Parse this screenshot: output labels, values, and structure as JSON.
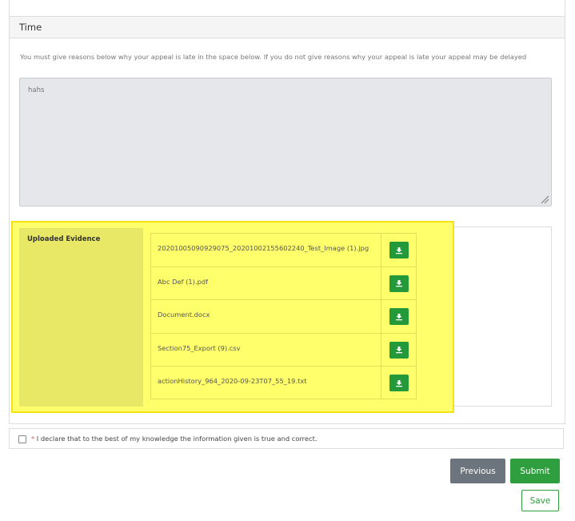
{
  "section": {
    "title": "Time",
    "instructions": "You must give reasons below why your appeal is late in the space below. If you do not give reasons why your appeal is late your appeal may be delayed",
    "reason_value": "hahs"
  },
  "evidence": {
    "label": "Uploaded Evidence",
    "files": [
      {
        "name": "20201005090929075_20201002155602240_Test_Image (1).jpg"
      },
      {
        "name": "Abc Def (1).pdf"
      },
      {
        "name": "Document.docx"
      },
      {
        "name": "Section75_Export (9).csv"
      },
      {
        "name": "actionHistory_964_2020-09-23T07_55_19.txt"
      }
    ],
    "download_icon": "download-icon"
  },
  "declaration": {
    "required_mark": "*",
    "text": "I declare that to the best of my knowledge the information given is true and correct."
  },
  "buttons": {
    "previous": "Previous",
    "submit": "Submit",
    "save": "Save"
  },
  "colors": {
    "highlight": "#ffff6b",
    "success": "#2e9e3e",
    "secondary": "#6c757d"
  }
}
